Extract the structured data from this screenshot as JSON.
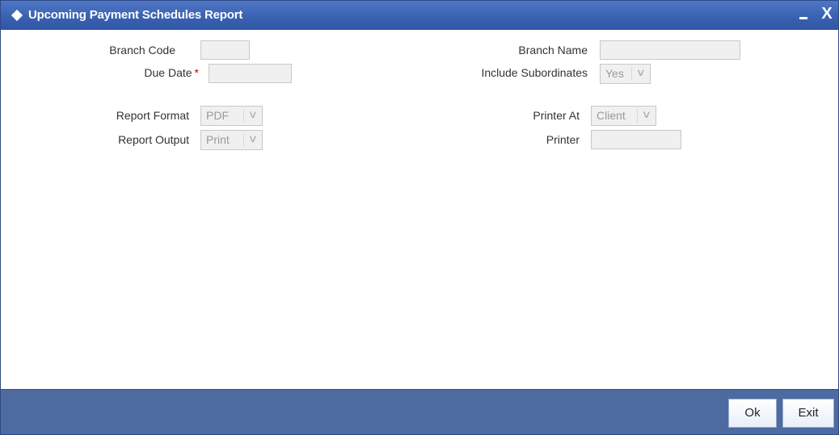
{
  "window": {
    "title": "Upcoming Payment Schedules Report",
    "minimize_label": "_",
    "close_label": "X"
  },
  "form": {
    "branch_code": {
      "label": "Branch Code",
      "value": ""
    },
    "due_date": {
      "label": "Due Date",
      "required_mark": "*",
      "value": ""
    },
    "branch_name": {
      "label": "Branch Name",
      "value": ""
    },
    "include_subordinates": {
      "label": "Include Subordinates",
      "selected": "Yes"
    },
    "report_format": {
      "label": "Report Format",
      "selected": "PDF"
    },
    "report_output": {
      "label": "Report Output",
      "selected": "Print"
    },
    "printer_at": {
      "label": "Printer At",
      "selected": "Client"
    },
    "printer": {
      "label": "Printer",
      "value": ""
    }
  },
  "footer": {
    "ok_label": "Ok",
    "exit_label": "Exit"
  },
  "colors": {
    "titlebar": "#3a62b1",
    "footer": "#4d6aa1",
    "required": "#cc0000",
    "field_bg": "#f0f0f0"
  },
  "icons": {
    "title": "diamond-icon",
    "dropdown": "chevron-down-icon"
  }
}
